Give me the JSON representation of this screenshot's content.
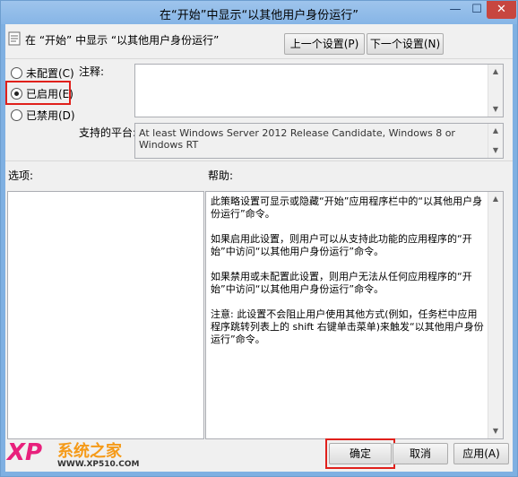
{
  "window": {
    "title": "在“开始”中显示“以其他用户身份运行”"
  },
  "header": {
    "policy_name": "在 “开始” 中显示 “以其他用户身份运行”",
    "prev_button": "上一个设置(P)",
    "next_button": "下一个设置(N)"
  },
  "state": {
    "options": [
      {
        "label": "未配置(C)",
        "selected": false
      },
      {
        "label": "已启用(E)",
        "selected": true
      },
      {
        "label": "已禁用(D)",
        "selected": false
      }
    ]
  },
  "comment": {
    "label": "注释:",
    "value": ""
  },
  "supported": {
    "label": "支持的平台:",
    "value": "At least Windows Server 2012 Release Candidate, Windows 8 or Windows RT"
  },
  "options_panel": {
    "label": "选项:"
  },
  "help_panel": {
    "label": "帮助:",
    "paragraphs": [
      "此策略设置可显示或隐藏“开始”应用程序栏中的“以其他用户身份运行”命令。",
      "如果启用此设置，则用户可以从支持此功能的应用程序的“开始”中访问“以其他用户身份运行”命令。",
      "如果禁用或未配置此设置，则用户无法从任何应用程序的“开始”中访问“以其他用户身份运行”命令。",
      "注意: 此设置不会阻止用户使用其他方式(例如，任务栏中应用程序跳转列表上的 shift 右键单击菜单)来触发“以其他用户身份运行”命令。"
    ]
  },
  "footer": {
    "ok": "确定",
    "cancel": "取消",
    "apply": "应用(A)"
  },
  "watermark": {
    "brand": "系统之家",
    "logo": "XP",
    "url": "WWW.XP510.COM"
  },
  "colors": {
    "highlight": "#e0201b",
    "close": "#c7463f",
    "titlebar": "#9ec4ec"
  }
}
